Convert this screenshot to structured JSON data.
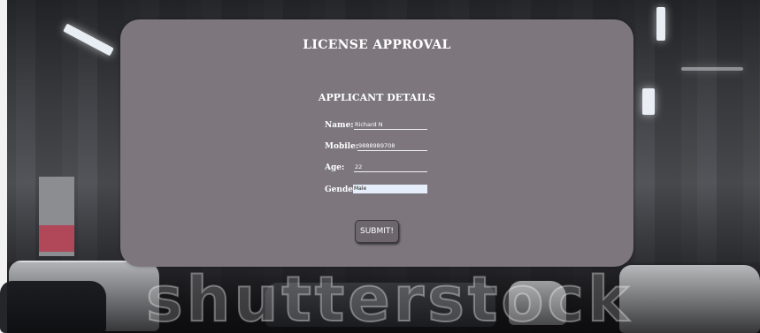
{
  "card": {
    "title": "LICENSE APPROVAL",
    "section_title": "APPLICANT DETAILS"
  },
  "form": {
    "name": {
      "label": "Name:",
      "value": "Richard N"
    },
    "mobile": {
      "label": "Mobile:",
      "value": "9888989708"
    },
    "age": {
      "label": "Age:",
      "value": "22"
    },
    "gender": {
      "label": "Gender:",
      "value": "Male"
    },
    "submit_label": "SUBMIT!"
  },
  "background": {
    "watermark": "shutterstock"
  },
  "colors": {
    "card": "#7d777d",
    "text": "#ffffff",
    "select_bg": "#e6eefb"
  }
}
